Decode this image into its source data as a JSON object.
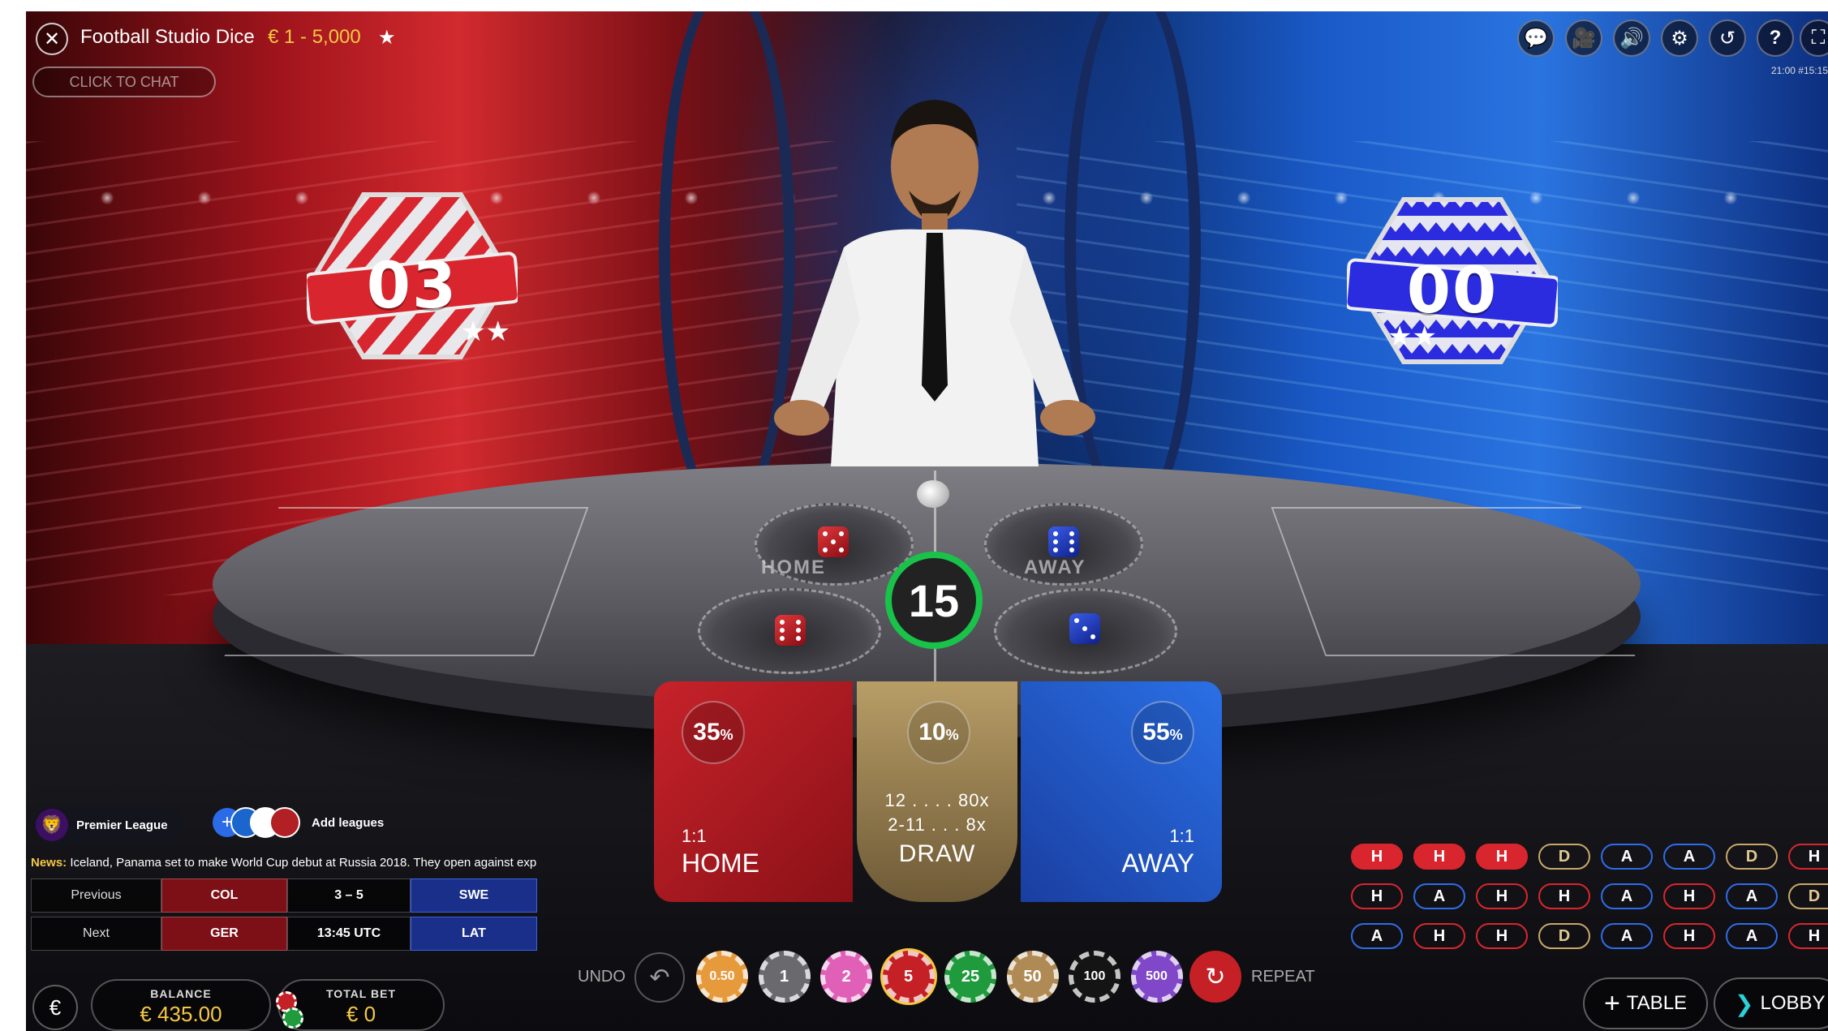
{
  "header": {
    "close_icon": "close-icon",
    "title": "Football Studio Dice",
    "limits": "€ 1 - 5,000",
    "pin_icon": "pin-icon",
    "chat_button": "CLICK TO CHAT",
    "icons": [
      "chat-icon",
      "camera-icon",
      "volume-icon",
      "settings-icon",
      "history-icon",
      "help-icon",
      "fullscreen-icon"
    ],
    "clock": "21:00 #15:15"
  },
  "scores": {
    "home": "03",
    "away": "00",
    "home_color": "#d9262e",
    "away_color": "#2b2be0"
  },
  "table": {
    "home_label": "HOME",
    "away_label": "AWAY",
    "timer": "15"
  },
  "bets": {
    "home": {
      "pct": "35",
      "pct_suffix": "%",
      "ratio": "1:1",
      "name": "HOME"
    },
    "draw": {
      "pct": "10",
      "pct_suffix": "%",
      "odds_1": "12 . . . . 80x",
      "odds_2": "2-11 . . . 8x",
      "name": "DRAW"
    },
    "away": {
      "pct": "55",
      "pct_suffix": "%",
      "ratio": "1:1",
      "name": "AWAY"
    }
  },
  "leagues": {
    "current": "Premier League",
    "add_label": "Add leagues"
  },
  "news": {
    "prefix": "News:",
    "text": "Iceland, Panama set to make World Cup debut at Russia 2018. They open against exp"
  },
  "fixtures": [
    {
      "label": "Previous",
      "home": "COL",
      "middle": "3 – 5",
      "away": "SWE"
    },
    {
      "label": "Next",
      "home": "GER",
      "middle": "13:45 UTC",
      "away": "LAT"
    }
  ],
  "bottom": {
    "currency_symbol": "€",
    "balance_label": "BALANCE",
    "balance_value": "€ 435.00",
    "total_bet_label": "TOTAL BET",
    "total_bet_value": "€ 0",
    "undo_label": "UNDO",
    "repeat_label": "REPEAT",
    "chips": [
      {
        "value": "0.50",
        "color": "#e79a3c"
      },
      {
        "value": "1",
        "color": "#6a6a6e"
      },
      {
        "value": "2",
        "color": "#e060b8"
      },
      {
        "value": "5",
        "color": "#c42026"
      },
      {
        "value": "25",
        "color": "#1f9a3c"
      },
      {
        "value": "50",
        "color": "#b08a54"
      },
      {
        "value": "100",
        "color": "#141414"
      },
      {
        "value": "500",
        "color": "#8048c8"
      }
    ],
    "selected_chip": "5",
    "table_button": "TABLE",
    "lobby_button": "LOBBY"
  },
  "roadmap": [
    [
      "H",
      "H",
      "H",
      "D",
      "A",
      "A",
      "D",
      "H"
    ],
    [
      "H",
      "A",
      "H",
      "H",
      "A",
      "H",
      "A",
      "D"
    ],
    [
      "A",
      "H",
      "H",
      "D",
      "A",
      "H",
      "A",
      "H"
    ]
  ]
}
